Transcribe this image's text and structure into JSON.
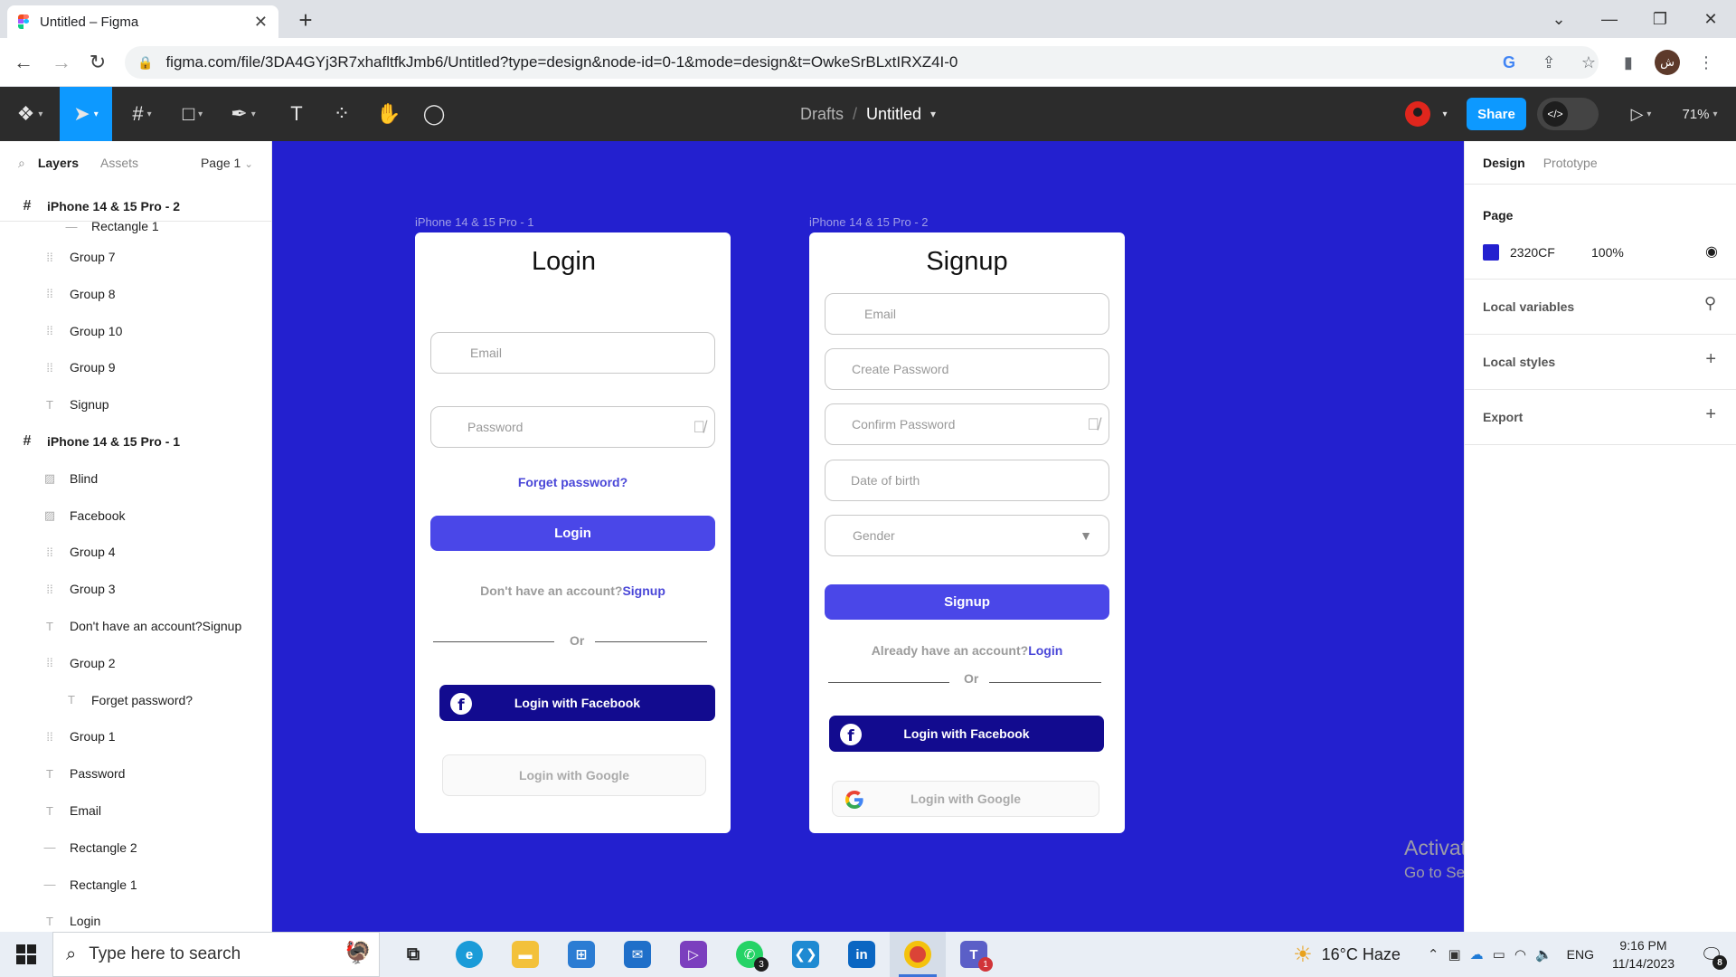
{
  "browser": {
    "tab_title": "Untitled – Figma",
    "url": "figma.com/file/3DA4GYj3R7xhafltfkJmb6/Untitled?type=design&node-id=0-1&mode=design&t=OwkeSrBLxtIRXZ4I-0",
    "profile_initial": "ش"
  },
  "toolbar": {
    "breadcrumb_drafts": "Drafts",
    "breadcrumb_sep": "/",
    "file_name": "Untitled",
    "share_label": "Share",
    "dev_mode_label": "</>",
    "zoom": "71%"
  },
  "left_panel": {
    "tab_layers": "Layers",
    "tab_assets": "Assets",
    "page_selector": "Page 1",
    "layers": [
      {
        "label": "iPhone 14 & 15 Pro - 2",
        "type": "frame",
        "icon": "frame-icon",
        "indent": 0
      },
      {
        "label": "Rectangle 1",
        "type": "rect",
        "icon": "rectangle-icon",
        "indent": 2
      },
      {
        "label": "Group 7",
        "type": "group",
        "icon": "group-icon",
        "indent": 1
      },
      {
        "label": "Group 8",
        "type": "group",
        "icon": "group-icon",
        "indent": 1
      },
      {
        "label": "Group 10",
        "type": "group",
        "icon": "group-icon",
        "indent": 1
      },
      {
        "label": "Group 9",
        "type": "group",
        "icon": "group-icon",
        "indent": 1
      },
      {
        "label": "Signup",
        "type": "text",
        "icon": "text-icon",
        "indent": 1
      },
      {
        "label": "iPhone 14 & 15 Pro - 1",
        "type": "frame",
        "icon": "frame-icon",
        "indent": 0
      },
      {
        "label": "Blind",
        "type": "image",
        "icon": "image-icon",
        "indent": 1
      },
      {
        "label": "Facebook",
        "type": "image",
        "icon": "image-icon",
        "indent": 1
      },
      {
        "label": "Group 4",
        "type": "group",
        "icon": "group-icon",
        "indent": 1
      },
      {
        "label": "Group 3",
        "type": "group",
        "icon": "group-icon",
        "indent": 1
      },
      {
        "label": "Don't have an account?Signup",
        "type": "text",
        "icon": "text-icon",
        "indent": 1
      },
      {
        "label": "Group 2",
        "type": "group",
        "icon": "group-icon",
        "indent": 1
      },
      {
        "label": "Forget password?",
        "type": "text",
        "icon": "text-icon",
        "indent": 2
      },
      {
        "label": "Group 1",
        "type": "group",
        "icon": "group-icon",
        "indent": 1
      },
      {
        "label": "Password",
        "type": "text",
        "icon": "text-icon",
        "indent": 1
      },
      {
        "label": "Email",
        "type": "text",
        "icon": "text-icon",
        "indent": 1
      },
      {
        "label": "Rectangle 2",
        "type": "rect",
        "icon": "rectangle-icon",
        "indent": 1
      },
      {
        "label": "Rectangle 1",
        "type": "rect",
        "icon": "rectangle-icon",
        "indent": 1
      },
      {
        "label": "Login",
        "type": "text",
        "icon": "text-icon",
        "indent": 1
      }
    ]
  },
  "canvas": {
    "background": "#2320CF",
    "login_frame": {
      "frame_label": "iPhone 14 & 15 Pro - 1",
      "title": "Login",
      "email_placeholder": "Email",
      "password_placeholder": "Password",
      "forgot": "Forget password?",
      "login_button": "Login",
      "no_account_prefix": "Don't have an account?",
      "no_account_link": "Signup",
      "or": "Or",
      "facebook_button": "Login with Facebook",
      "google_button": "Login with Google"
    },
    "signup_frame": {
      "frame_label": "iPhone 14 & 15 Pro - 2",
      "title": "Signup",
      "email_placeholder": "Email",
      "create_password_placeholder": "Create Password",
      "confirm_password_placeholder": "Confirm Password",
      "dob_placeholder": "Date of birth",
      "gender_placeholder": "Gender",
      "signup_button": "Signup",
      "have_account_prefix": "Already have an account?",
      "have_account_link": "Login",
      "or": "Or",
      "facebook_button": "Login with Facebook",
      "google_button": "Login with Google"
    },
    "activate_line1": "Activate Windows",
    "activate_line2": "Go to Settings to activate Windows."
  },
  "right_panel": {
    "tab_design": "Design",
    "tab_prototype": "Prototype",
    "page_section": "Page",
    "page_color_hex": "2320CF",
    "page_color_opacity": "100%",
    "local_variables": "Local variables",
    "local_styles": "Local styles",
    "export": "Export"
  },
  "taskbar": {
    "search_placeholder": "Type here to search",
    "weather": "16°C  Haze",
    "language": "ENG",
    "time": "9:16 PM",
    "date": "11/14/2023",
    "whatsapp_badge": "3",
    "teams_badge": "1",
    "notification_count": "8"
  },
  "colors": {
    "figma_blue": "#0D99FF",
    "canvas": "#2320CF",
    "primary_button": "#4A47E8",
    "facebook_button": "#120B8F"
  }
}
